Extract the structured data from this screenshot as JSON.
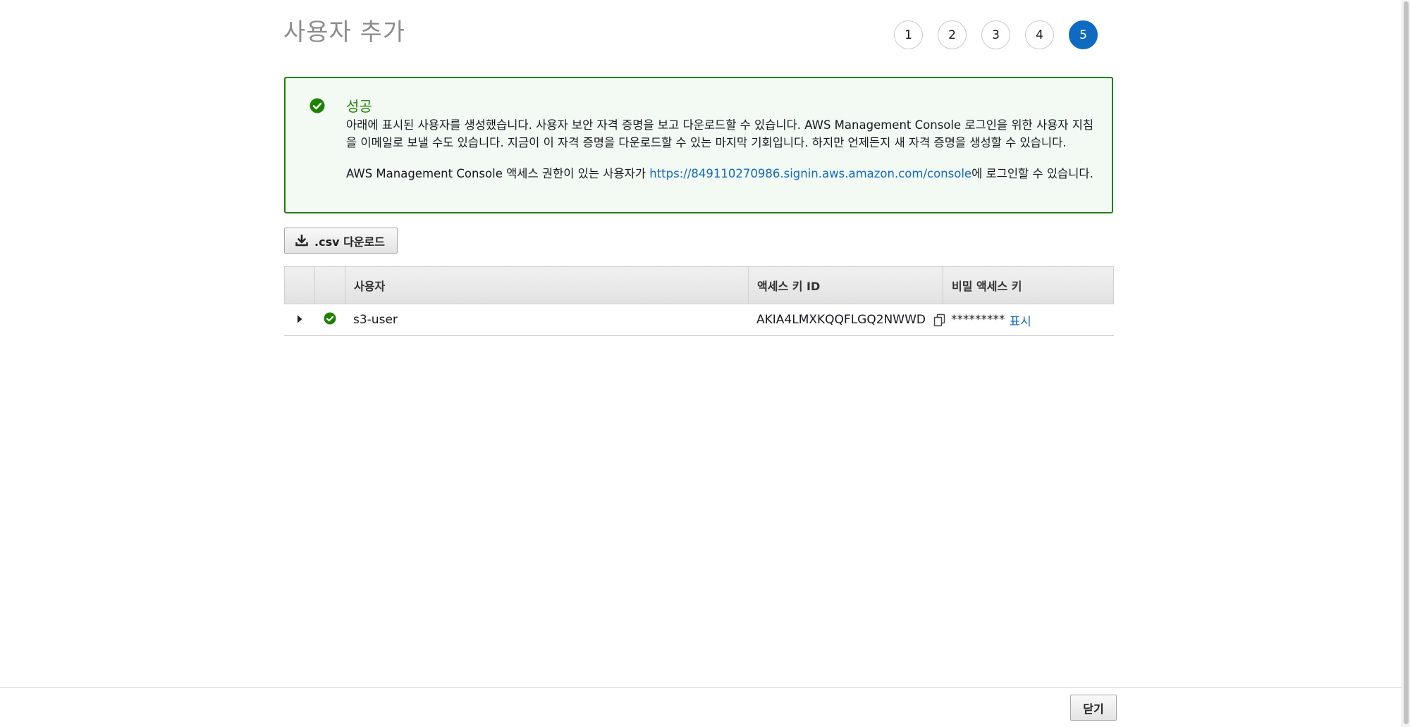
{
  "page": {
    "title": "사용자 추가"
  },
  "steps": {
    "items": [
      "1",
      "2",
      "3",
      "4",
      "5"
    ],
    "active": "5"
  },
  "alert": {
    "icon": "check-circle-icon",
    "title": "성공",
    "message_line": "아래에 표시된 사용자를 생성했습니다. 사용자 보안 자격 증명을 보고 다운로드할 수 있습니다. AWS Management Console 로그인을 위한 사용자 지침을 이메일로 보낼 수도 있습니다. 지금이 이 자격 증명을 다운로드할 수 있는 마지막 기회입니다. 하지만 언제든지 새 자격 증명을 생성할 수 있습니다.",
    "console_prefix": "AWS Management Console 액세스 권한이 있는 사용자가 ",
    "console_link": "https://849110270986.signin.aws.amazon.com/console",
    "console_suffix": "에 로그인할 수 있습니다."
  },
  "toolbar": {
    "csv_icon": "download-icon",
    "csv_label": ".csv 다운로드"
  },
  "table": {
    "columns": [
      "사용자",
      "액세스 키 ID",
      "비밀 액세스 키"
    ],
    "rows": [
      {
        "user": "s3-user",
        "access_key_id": "AKIA4LMXKQQFLGQ2NWWD",
        "secret_masked": "*********",
        "show_label": "표시"
      }
    ]
  },
  "footer": {
    "close_label": "닫기"
  },
  "colors": {
    "success": "#1d8102",
    "accent": "#0f6ac2"
  }
}
